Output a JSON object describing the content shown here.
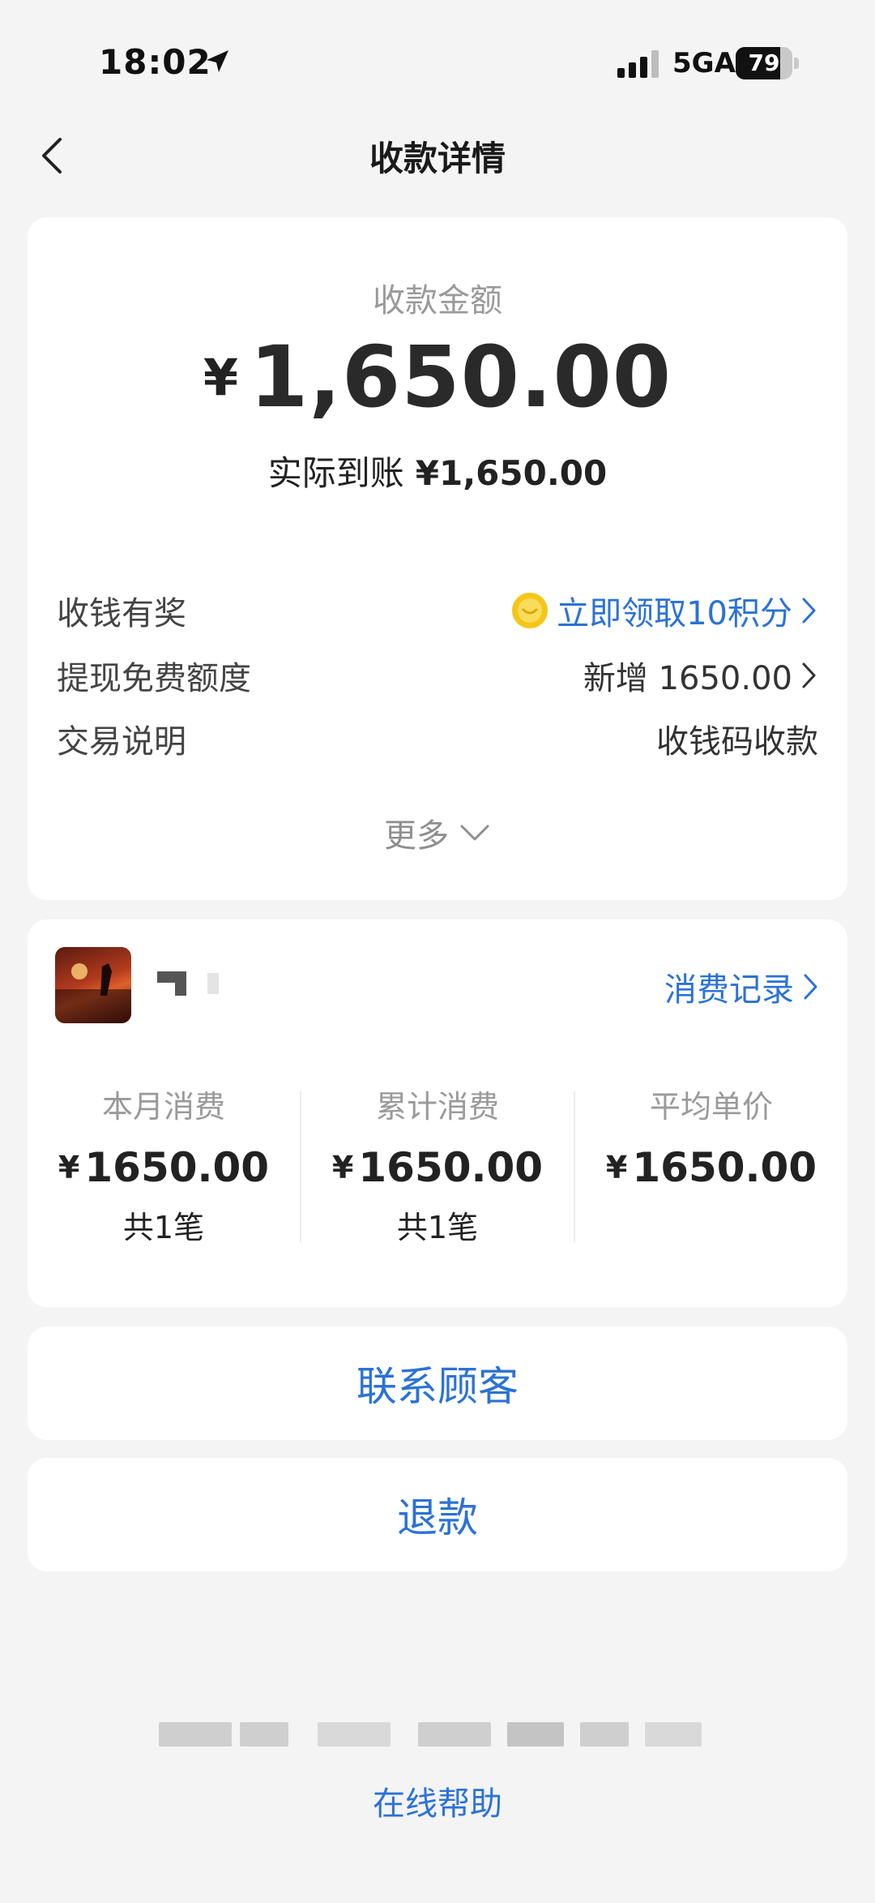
{
  "status_bar": {
    "time": "18:02",
    "network": "5GA",
    "battery": "79",
    "battery_level": 0.79
  },
  "nav": {
    "title": "收款详情"
  },
  "main_card": {
    "amount_label": "收款金额",
    "currency_symbol": "¥",
    "amount": "1,650.00",
    "actual_label": "实际到账",
    "actual_amount": "¥1,650.00",
    "rows": [
      {
        "label": "收钱有奖",
        "value": "立即领取10积分"
      },
      {
        "label": "提现免费额度",
        "value": "新增 1650.00"
      },
      {
        "label": "交易说明",
        "value": "收钱码收款"
      }
    ],
    "more_label": "更多"
  },
  "customer_card": {
    "records_link": "消费记录",
    "stats": [
      {
        "label": "本月消费",
        "symbol": "¥",
        "value": "1650.00",
        "count": "共1笔"
      },
      {
        "label": "累计消费",
        "symbol": "¥",
        "value": "1650.00",
        "count": "共1笔"
      },
      {
        "label": "平均单价",
        "symbol": "¥",
        "value": "1650.00",
        "count": ""
      }
    ]
  },
  "actions": {
    "contact": "联系顾客",
    "refund": "退款"
  },
  "footer": {
    "help": "在线帮助"
  },
  "colors": {
    "accent": "#2b72d6",
    "background": "#f4f4f4",
    "card": "#ffffff"
  }
}
